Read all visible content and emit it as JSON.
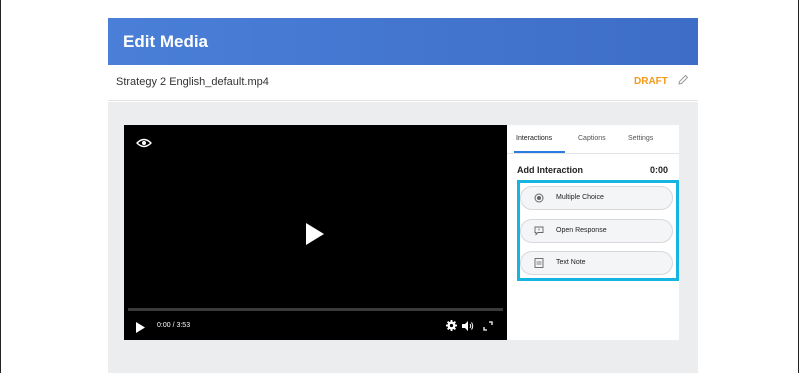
{
  "header": {
    "title": "Edit Media"
  },
  "file": {
    "name": "Strategy 2 English_default.mp4",
    "status": "DRAFT"
  },
  "player": {
    "time": "0:00 / 3:53",
    "progress_fraction": 0.0
  },
  "side_panel": {
    "tabs": [
      {
        "label": "Interactions",
        "active": true
      },
      {
        "label": "Captions",
        "active": false
      },
      {
        "label": "Settings",
        "active": false
      }
    ],
    "add_interaction_label": "Add Interaction",
    "add_interaction_time": "0:00",
    "options": [
      {
        "label": "Multiple Choice",
        "icon": "radio-icon"
      },
      {
        "label": "Open Response",
        "icon": "speech-bubble-icon"
      },
      {
        "label": "Text Note",
        "icon": "note-icon"
      }
    ]
  },
  "colors": {
    "header_bg": "#4a7fd8",
    "draft": "#f39a1b",
    "highlight": "#16b4e0",
    "active_tab": "#2a7be4"
  }
}
